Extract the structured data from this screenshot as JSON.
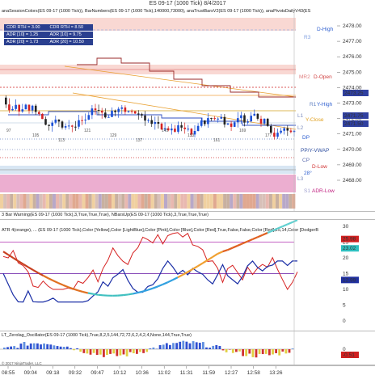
{
  "title": "ES 09-17 (1000 Tick)  8/4/2017",
  "panels": {
    "price_legend": "anaSessionColors(ES 09-17 (1000 Tick)), BarNumbers(ES 09-17 (1000 Tick),140000,73000), anaTrustBarsV2(ES 09-17 (1000 Tick)), anaPivotsDailyV43(ES",
    "osc1_legend": "3 Bar Warning(ES 09-17 (1000 Tick),3,True,True,True), NBarsUp(ES 09-17 (1000 Tick),3,True,True,True)",
    "osc2_legend": "ATR 4(orange), ... (ES 09-17 (1000 Tick),Color [Yellow],Color [LightBlue],Color [Pink],Color [Blue],Color [Red],True,False,False,Color [Red],25,14,Color [DodgerB",
    "osc3_legend": "LT_Zerolag_Oscillator(ES 09-17 (1000 Tick),True,8,2,5,144,72,72,6,2,4,2,4,None,144,True,True)"
  },
  "stats": [
    {
      "left": "CDR RTH = 3.00",
      "right": "CDR RTH = 8.50"
    },
    {
      "left": "ADR [10] = 1.25",
      "right": "ADR [10] = 9.75"
    },
    {
      "left": "ADR [20] = 1.73",
      "right": "ADR [20] = 10.50"
    }
  ],
  "pivot_labels": {
    "d_high": "D-High",
    "r3": "R3",
    "mr2": "MR2",
    "d_open": "D-Open",
    "y_high": "Y-High",
    "r1": "R1",
    "y_close": "Y-Close",
    "dp": "DP",
    "pp_vwap": "PP/Y-VWAP",
    "cp": "CP",
    "d_low": "D-Low",
    "deg": "28°",
    "s1": "S1",
    "adr_low": "ADR-Low",
    "l3": "L3",
    "l1": "L1",
    "l2": "L2"
  },
  "price_axis": {
    "ticks": [
      "2478.00",
      "2477.00",
      "2476.00",
      "2475.00",
      "2474.00",
      "2473.00",
      "2472.00",
      "2471.00",
      "2470.00",
      "2469.00",
      "2468.00"
    ],
    "current": "2473.25",
    "current2": "2471.50",
    "current3": "2471.75"
  },
  "osc2_axis": {
    "ticks": [
      "30",
      "25",
      "20",
      "15",
      "10",
      "5",
      "0"
    ],
    "tag_red": "25.98",
    "tag_cyan": "23.02",
    "tag_blue": "12.99"
  },
  "osc3_axis": {
    "ticks": [
      "0"
    ],
    "tag_red": "-0.51"
  },
  "time_axis": [
    "08:55",
    "09:04",
    "09:18",
    "09:32",
    "09:47",
    "10:12",
    "10:36",
    "11:02",
    "11:31",
    "11:59",
    "12:27",
    "12:58",
    "13:26"
  ],
  "copyright": "© 2017 NinjaTrader, LLC",
  "bar_numbers": [
    "97",
    "105",
    "113",
    "121",
    "129",
    "137",
    "145",
    "153",
    "161",
    "169",
    "177"
  ],
  "colors": {
    "up": "#1a4fd6",
    "down": "#d62222",
    "neutral": "#222222",
    "pivot_band": "#f7c8c0",
    "adr_band": "#e9a0c8",
    "rsi_red": "#d62222",
    "rsi_blue": "#1b2fa6",
    "smooth": "#ff8c00"
  }
}
